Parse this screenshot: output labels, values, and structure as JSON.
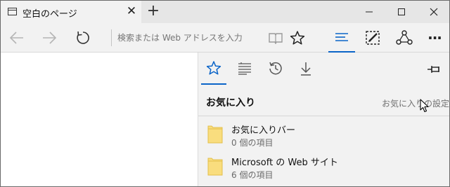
{
  "tab": {
    "title": "空白のページ",
    "close_glyph": "✕",
    "new_tab_glyph": "+"
  },
  "window_controls": {
    "minimize": "minimize-icon",
    "maximize": "maximize-icon",
    "close": "close-icon"
  },
  "toolbar": {
    "address_placeholder": "検索または Web アドレスを入力",
    "icons": [
      "back-arrow-icon",
      "forward-arrow-icon",
      "refresh-icon",
      "reading-view-icon",
      "favorite-star-icon",
      "hub-icon",
      "web-note-icon",
      "share-icon",
      "more-icon"
    ],
    "more_glyph": "···"
  },
  "hub": {
    "tabs": [
      "favorites-star-icon",
      "reading-list-icon",
      "history-icon",
      "downloads-icon"
    ],
    "title": "お気に入り",
    "settings_link": "お気に入りの設定",
    "items": [
      {
        "name": "お気に入りバー",
        "count": "0 個の項目"
      },
      {
        "name": "Microsoft の Web サイト",
        "count": "6 個の項目"
      }
    ]
  },
  "colors": {
    "accent": "#0a64c8",
    "folder": "#f9dd7e",
    "pane_bg": "#f2f2f2",
    "titlebar_bg": "#e6e6e6"
  }
}
